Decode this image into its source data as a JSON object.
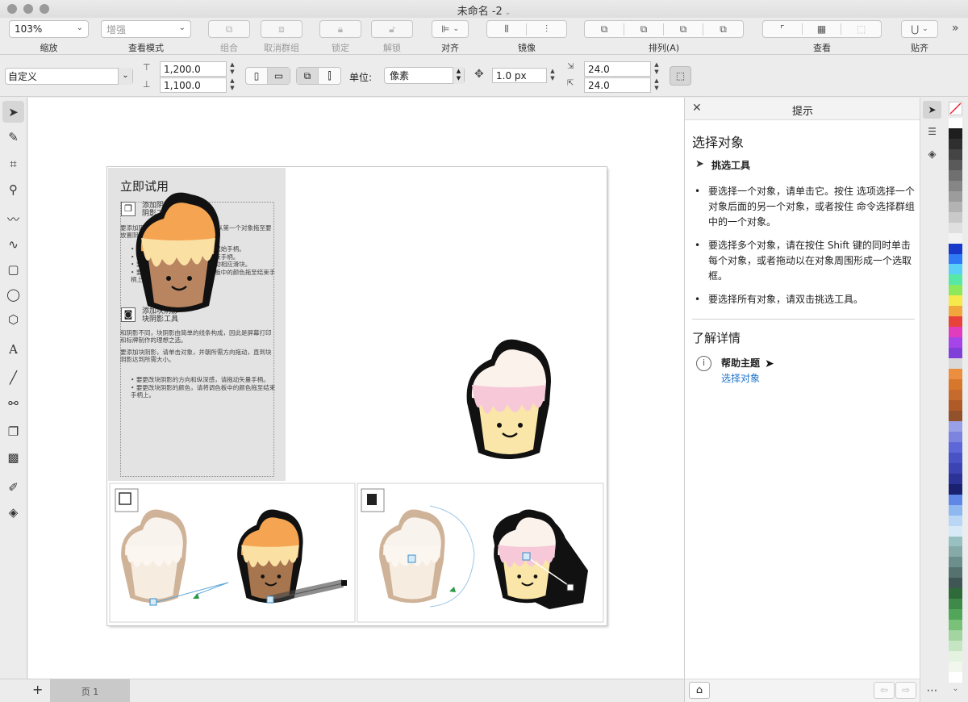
{
  "window": {
    "title": "未命名 -2"
  },
  "toolbar": {
    "zoom": {
      "value": "103%",
      "label": "缩放"
    },
    "view_mode": {
      "value": "增强",
      "label": "查看模式"
    },
    "group_label": "组合",
    "ungroup_label": "取消群组",
    "lock_label": "锁定",
    "unlock_label": "解锁",
    "align_label": "对齐",
    "mirror_label": "镜像",
    "arrange_label": "排列(A)",
    "view_label": "查看",
    "snap_label": "贴齐",
    "more_icon": "double-chevron-right-icon"
  },
  "properties": {
    "page_preset": "自定义",
    "width": "1,200.0",
    "height": "1,100.0",
    "units_label": "单位:",
    "units_value": "像素",
    "nudge": "1.0 px",
    "dup_x": "24.0",
    "dup_y": "24.0"
  },
  "hints": {
    "title": "提示",
    "section_title": "选择对象",
    "tool_name": "挑选工具",
    "bullets": [
      "要选择一个对象，请单击它。按住 选项选择一个对象后面的另一个对象，或者按住 命令选择群组中的一个对象。",
      "要选择多个对象，请在按住 Shift 键的同时单击每个对象，或者拖动以在对象周围形成一个选取框。",
      "要选择所有对象，请双击挑选工具。"
    ],
    "learn_more": "了解详情",
    "help_topic": "帮助主题",
    "help_link": "选择对象"
  },
  "document": {
    "try_title": "立即试用",
    "shadow_tool_title": "添加阴影",
    "shadow_tool_sub": "阴影工具",
    "shadow_intro": "要添加阴影，请单击相应对象，然后从第一个对象拖至要放置阴影的位置。",
    "shadow_bullets": [
      "要更改阴影的透视点，请拖动起始手柄。",
      "要更改阴影的方向，请拖动结束手柄。",
      "要调整阴影的不透明度，请移动相应滑块。",
      "要更改阴影的颜色，请将调色板中的颜色拖至结束手柄上。"
    ],
    "block_tool_title": "添加块阴影",
    "block_tool_sub": "块阴影工具",
    "block_intro_1": "和阴影不同，块阴影由简单的线条构成，因此是屏幕打印和标牌制作的理想之选。",
    "block_intro_2": "要添加块阴影，请单击对象，并朝所需方向拖动，直到块阴影达到所需大小。",
    "block_bullets": [
      "要更改块阴影的方向和纵深感，请拖动矢量手柄。",
      "要更改块阴影的颜色，请将调色板中的颜色拖至结束手柄上。"
    ]
  },
  "page_tabs": {
    "add": "+",
    "current": "页 1"
  },
  "palette_colors": [
    "#ffffff",
    "#1e1e1e",
    "#2f2f2f",
    "#444444",
    "#5a5a5a",
    "#707070",
    "#868686",
    "#9c9c9c",
    "#b3b3b3",
    "#c9c9c9",
    "#dfdfdf",
    "#f2f2f2",
    "#1738c8",
    "#2f7af5",
    "#5ad0f6",
    "#58e8a6",
    "#8de85b",
    "#f5ea4a",
    "#f2a73c",
    "#e8433b",
    "#e03dbe",
    "#a544e8",
    "#7f3fd9",
    "#d9d9d9",
    "#ec8e3f",
    "#d6772b",
    "#c76a2e",
    "#b05a28",
    "#92512b",
    "#9aa0e6",
    "#7c84e0",
    "#5d67d8",
    "#4a53c6",
    "#3b44b2",
    "#2b3496",
    "#1a2170",
    "#5f88e6",
    "#8fb7f0",
    "#b9d6f4",
    "#d7e9f6",
    "#99c0c0",
    "#86aaa8",
    "#6c8e8c",
    "#55726f",
    "#3e5754",
    "#2f6a3a",
    "#3f8a48",
    "#52a65a",
    "#79c178",
    "#a2d59f",
    "#c6e6c3",
    "#e4f2e0",
    "#f2f7ee",
    "#ffffff"
  ]
}
